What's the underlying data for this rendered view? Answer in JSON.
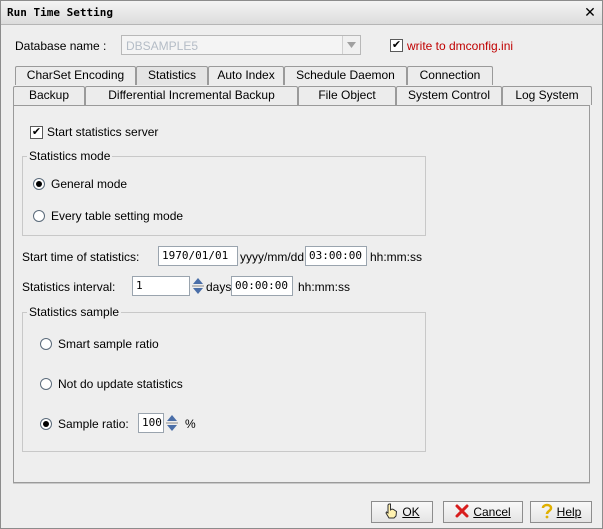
{
  "window": {
    "title": "Run Time Setting",
    "close_glyph": "✕"
  },
  "db": {
    "label": "Database name :",
    "value": "DBSAMPLE5",
    "write_checked": true,
    "write_label": "write to dmconfig.ini"
  },
  "tabs_row1": [
    "CharSet Encoding",
    "Statistics",
    "Auto Index",
    "Schedule Daemon",
    "Connection"
  ],
  "tabs_row2": [
    "Backup",
    "Differential Incremental Backup",
    "File Object",
    "System Control",
    "Log System"
  ],
  "active_tab": "Statistics",
  "stats": {
    "start_server_checked": true,
    "start_server_label": "Start statistics server",
    "mode_group_title": "Statistics mode",
    "mode_general": "General mode",
    "mode_every_table": "Every table setting mode",
    "mode_selected": "General mode",
    "start_time_label": "Start time of statistics:",
    "start_date": "1970/01/01",
    "date_format": "yyyy/mm/dd",
    "start_time": "03:00:00",
    "time_format": "hh:mm:ss",
    "interval_label": "Statistics interval:",
    "interval_days": "1",
    "days_label": "days",
    "interval_time": "00:00:00",
    "interval_time_format": "hh:mm:ss",
    "sample_group_title": "Statistics sample",
    "sample_smart": "Smart sample ratio",
    "sample_none": "Not do update statistics",
    "sample_ratio_label": "Sample ratio:",
    "sample_ratio_value": "100",
    "sample_ratio_unit": "%",
    "sample_selected": "Sample ratio"
  },
  "buttons": {
    "ok": "OK",
    "cancel": "Cancel",
    "help": "Help"
  },
  "icons": {
    "ok": "hand-pointer-icon",
    "cancel": "red-x-icon",
    "help": "question-mark-icon"
  }
}
